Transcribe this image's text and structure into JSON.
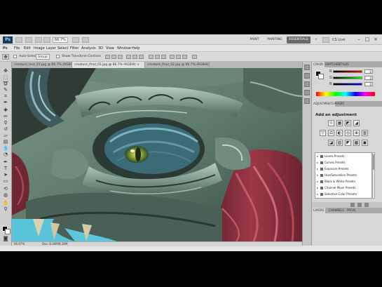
{
  "app": {
    "logo": "Ps",
    "zoom": "66.7%",
    "workspaces": [
      "PAINT",
      "PAINTING",
      "ESSENTIALS"
    ],
    "active_workspace": "ESSENTIALS",
    "cs_live": "CS Live",
    "window_controls": {
      "minimize": "–",
      "maximize": "□",
      "close": "×"
    }
  },
  "menu": [
    "Ps",
    "File",
    "Edit",
    "Image",
    "Layer",
    "Select",
    "Filter",
    "Analysis",
    "3D",
    "View",
    "Window",
    "Help"
  ],
  "options": {
    "auto_select_label": "Auto-Select:",
    "auto_select_value": "Group",
    "show_transform_label": "Show Transform Controls"
  },
  "doc_tabs": [
    {
      "label": "creature_test_01.jpg @ 66.7% (RGB/8)",
      "active": false
    },
    {
      "label": "creature_final_01.jpg @ 66.7% (RGB/8) ×",
      "active": true
    },
    {
      "label": "creature_final_02.jpg @ 66.7% (RGB/8)",
      "active": false
    }
  ],
  "status": {
    "zoom": "66.67%",
    "doc": "Doc: 8.36M/8.36M"
  },
  "panels": {
    "color_tabs": [
      "COLOR",
      "SWATCHES",
      "STYLES"
    ],
    "rgb": [
      {
        "channel": "R",
        "value": "0"
      },
      {
        "channel": "G",
        "value": "0"
      },
      {
        "channel": "B",
        "value": "0"
      }
    ],
    "adjust_tabs": [
      "ADJUSTMENTS",
      "MASKS"
    ],
    "adjust_title": "Add an adjustment",
    "adjust_icons_row1": [
      "☼",
      "▦",
      "◩",
      "◢"
    ],
    "adjust_icons_row2": [
      "▽",
      "⚖",
      "◐",
      "◎",
      "⊕",
      "▥"
    ],
    "adjust_icons_row3": [
      "◪",
      "▨",
      "◤",
      "▩",
      "▣"
    ],
    "presets": [
      "Levels Presets",
      "Curves Presets",
      "Exposure Presets",
      "Hue/Saturation Presets",
      "Black & White Presets",
      "Channel Mixer Presets",
      "Selective Color Presets"
    ],
    "bottom_tabs": [
      "LAYERS",
      "CHANNELS",
      "PATHS"
    ]
  },
  "colors": {
    "workspace_active": "#6a6a6a",
    "canvas_cyan": "#59c3d8",
    "flesh": "#8e2e3a"
  }
}
